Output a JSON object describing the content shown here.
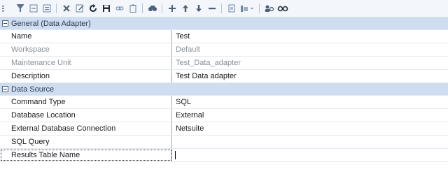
{
  "toolbar": {
    "buttons": [
      {
        "icon": "partial-filter-icon"
      },
      {
        "icon": "filter-icon"
      },
      {
        "icon": "collapse-all-icon"
      },
      {
        "icon": "expand-all-icon"
      },
      {
        "sep": true
      },
      {
        "icon": "delete-icon"
      },
      {
        "icon": "edit-icon"
      },
      {
        "icon": "refresh-icon"
      },
      {
        "icon": "save-icon"
      },
      {
        "icon": "link-icon"
      },
      {
        "icon": "clipboard-icon"
      },
      {
        "sep": true
      },
      {
        "icon": "find-icon"
      },
      {
        "sep": true
      },
      {
        "icon": "add-icon"
      },
      {
        "icon": "move-up-icon"
      },
      {
        "icon": "move-down-icon"
      },
      {
        "icon": "remove-icon"
      },
      {
        "sep": true
      },
      {
        "icon": "document-icon"
      },
      {
        "icon": "view-dropdown-icon"
      },
      {
        "sep": true
      },
      {
        "icon": "users-search-icon"
      },
      {
        "icon": "glasses-icon"
      }
    ]
  },
  "sections": [
    {
      "title": "General (Data Adapter)",
      "rows": [
        {
          "label": "Name",
          "value": "Test",
          "dim": false
        },
        {
          "label": "Workspace",
          "value": "Default",
          "dim": true
        },
        {
          "label": "Maintenance Unit",
          "value": "Test_Data_adapter",
          "dim": true
        },
        {
          "label": "Description",
          "value": "Test Data adapter",
          "dim": false
        }
      ]
    },
    {
      "title": "Data Source",
      "rows": [
        {
          "label": "Command Type",
          "value": "SQL",
          "dim": false
        },
        {
          "label": "Database Location",
          "value": "External",
          "dim": false
        },
        {
          "label": "External Database Connection",
          "value": "Netsuite",
          "dim": false
        },
        {
          "label": "SQL Query",
          "value": "",
          "dim": false
        },
        {
          "label": "Results Table Name",
          "value": "",
          "dim": false,
          "selected": true
        }
      ]
    }
  ]
}
